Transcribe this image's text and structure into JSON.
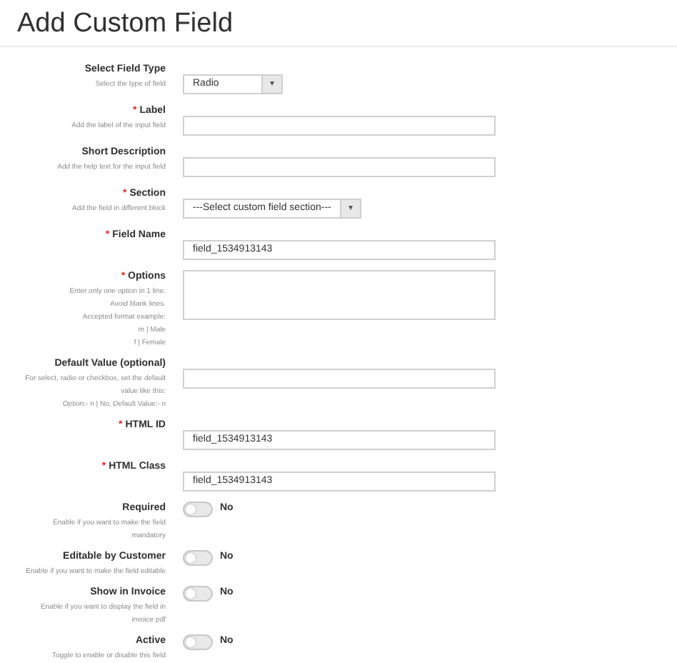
{
  "title": "Add Custom Field",
  "fields": [
    {
      "kind": "select",
      "label": "Select Field Type",
      "hints": [
        "Select the type of field"
      ],
      "value": "Radio",
      "caret": "▾"
    },
    {
      "kind": "text",
      "label": "Label",
      "mark": "*",
      "hints": [
        "Add the label of the input field"
      ]
    },
    {
      "kind": "text",
      "label": "Short Description",
      "hints": [
        "Add the help text for the input field"
      ]
    },
    {
      "kind": "select",
      "label": "Section",
      "mark": "*",
      "hints": [
        "Add the field in different block"
      ],
      "value": "---Select custom field section---",
      "caret": "▾"
    },
    {
      "kind": "text",
      "label": "Field Name",
      "mark": "*",
      "value": "field_1534913143"
    },
    {
      "kind": "textarea",
      "label": "Options",
      "mark": "*",
      "hints": [
        "Enter only one option in 1 line.",
        "Avoid blank lines.",
        "Accepted format example:",
        "m | Male",
        "f | Female"
      ]
    },
    {
      "kind": "text",
      "label": "Default Value (optional)",
      "hints": [
        "For select, radio or checkbox, set the default",
        "value like this:",
        "Option:- n | No, Default Value:- n"
      ]
    },
    {
      "kind": "text",
      "label": "HTML ID",
      "mark": "*",
      "value": "field_1534913143"
    },
    {
      "kind": "text",
      "label": "HTML Class",
      "mark": "*",
      "value": "field_1534913143"
    },
    {
      "kind": "toggle",
      "label": "Required",
      "hints": [
        "Enable if you want to make the field",
        "mandatory"
      ],
      "on": false,
      "state": "No"
    },
    {
      "kind": "toggle",
      "label": "Editable by Customer",
      "hints": [
        "Enable if you want to make the field editable"
      ],
      "on": false,
      "state": "No"
    },
    {
      "kind": "toggle",
      "label": "Show in Invoice",
      "hints": [
        "Enable if you want to display the field in",
        "invoice pdf"
      ],
      "on": false,
      "state": "No"
    },
    {
      "kind": "toggle",
      "label": "Active",
      "hints": [
        "Toggle to enable or disable this field"
      ],
      "on": false,
      "state": "No"
    }
  ]
}
